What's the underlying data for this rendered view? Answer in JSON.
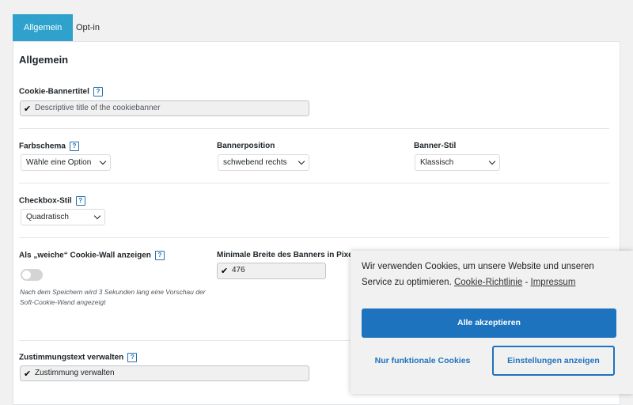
{
  "tabs": [
    {
      "label": "Allgemein",
      "active": true
    },
    {
      "label": "Opt-in",
      "active": false
    }
  ],
  "section_title": "Allgemein",
  "help_glyph": "?",
  "check_glyph": "✔",
  "fields": {
    "banner_title": {
      "label": "Cookie-Bannertitel",
      "placeholder": "Descriptive title of the cookiebanner"
    },
    "color_scheme": {
      "label": "Farbschema",
      "value": "Wähle eine Option"
    },
    "banner_position": {
      "label": "Bannerposition",
      "value": "schwebend rechts"
    },
    "banner_style": {
      "label": "Banner-Stil",
      "value": "Klassisch"
    },
    "checkbox_style": {
      "label": "Checkbox-Stil",
      "value": "Quadratisch"
    },
    "soft_cookie_wall": {
      "label": "Als „weiche“ Cookie-Wall anzeigen",
      "enabled": false,
      "note": "Nach dem Speichern wird 3 Sekunden lang eine Vorschau der Soft-Cookie-Wand angezeigt"
    },
    "min_width": {
      "label": "Minimale Breite des Banners in Pixeln",
      "value": "476"
    },
    "consent_text": {
      "label": "Zustimmungstext verwalten",
      "value": "Zustimmung verwalten"
    }
  },
  "cookie_banner": {
    "message": "Wir verwenden Cookies, um unsere Website und unseren Service zu optimieren.",
    "link_policy": "Cookie-Richtlinie",
    "separator": "-",
    "link_imprint": "Impressum",
    "accept_label": "Alle akzeptieren",
    "functional_label": "Nur funktionale Cookies",
    "settings_label": "Einstellungen anzeigen",
    "accent_color": "#1e73be"
  },
  "colors": {
    "tab_active": "#2ea2cc",
    "help": "#2271b1"
  }
}
